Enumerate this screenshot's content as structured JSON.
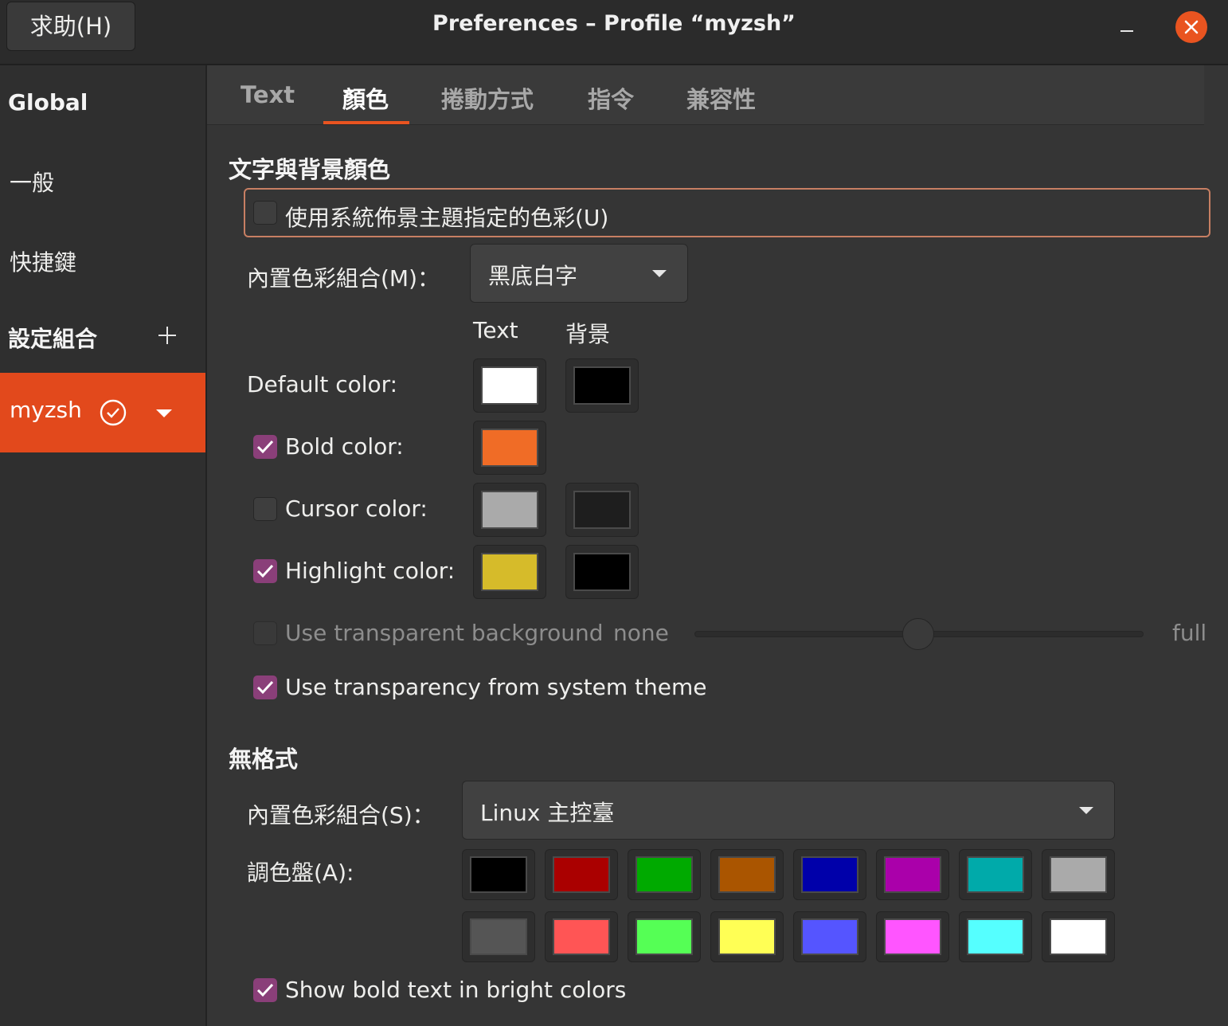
{
  "window": {
    "title": "Preferences – Profile “myzsh”",
    "help_button": "求助(H)"
  },
  "sidebar": {
    "global_heading": "Global",
    "items": [
      "一般",
      "快捷鍵"
    ],
    "profiles_heading": "設定組合",
    "active_profile": "myzsh"
  },
  "tabs": [
    "Text",
    "顏色",
    "捲動方式",
    "指令",
    "兼容性"
  ],
  "active_tab": "顏色",
  "colors_section": {
    "title": "文字與背景顏色",
    "use_system_theme": {
      "label": "使用系統佈景主題指定的色彩(U)",
      "checked": false
    },
    "builtin_scheme_label": "內置色彩組合(M)：",
    "builtin_scheme_value": "黑底白字",
    "col_text": "Text",
    "col_background": "背景",
    "default_color": {
      "label": "Default color:",
      "text": "#ffffff",
      "background": "#000000"
    },
    "bold_color": {
      "label": "Bold color:",
      "checked": true,
      "text": "#f06c26"
    },
    "cursor_color": {
      "label": "Cursor color:",
      "checked": false,
      "text": "#aaaaaa",
      "background": "#1e1e1e"
    },
    "highlight_color": {
      "label": "Highlight color:",
      "checked": true,
      "text": "#d6bb2a",
      "background": "#000000"
    },
    "transparent_bg": {
      "label": "Use transparent background",
      "checked": false,
      "min_label": "none",
      "max_label": "full",
      "level": 0.5
    },
    "system_transparency": {
      "label": "Use transparency from system theme",
      "checked": true
    }
  },
  "palette_section": {
    "title": "無格式",
    "builtin_scheme_label": "內置色彩組合(S)：",
    "builtin_scheme_value": "Linux 主控臺",
    "palette_label": "調色盤(A):",
    "row1": [
      "#000000",
      "#aa0000",
      "#00aa00",
      "#aa5500",
      "#0000aa",
      "#aa00aa",
      "#00aaaa",
      "#aaaaaa"
    ],
    "row2": [
      "#555555",
      "#ff5555",
      "#55ff55",
      "#ffff55",
      "#5555ff",
      "#ff55ff",
      "#55ffff",
      "#ffffff"
    ],
    "bright_bold": {
      "label": "Show bold text in bright colors",
      "checked": true
    }
  }
}
